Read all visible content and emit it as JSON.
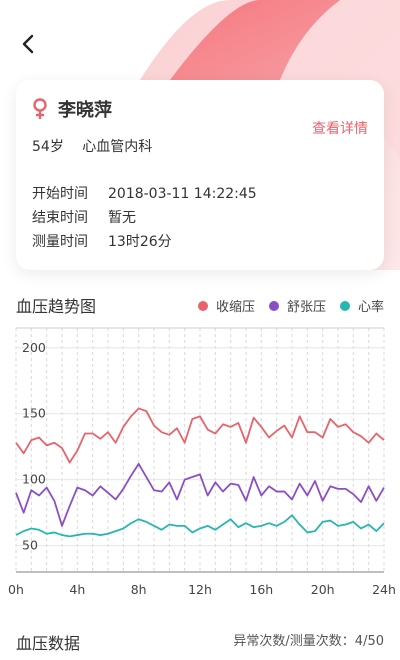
{
  "patient": {
    "name": "李晓萍",
    "age": "54岁",
    "department": "心血管内科",
    "detail_link": "查看详情"
  },
  "info_rows": [
    {
      "label": "开始时间",
      "value": "2018-03-11 14:22:45"
    },
    {
      "label": "结束时间",
      "value": "暂无"
    },
    {
      "label": "测量时间",
      "value": "13时26分"
    }
  ],
  "chart_section": {
    "title": "血压趋势图"
  },
  "data_section": {
    "title": "血压数据",
    "summary": "异常次数/测量次数：4/50"
  },
  "icons": {
    "back": "chevron-left-icon",
    "gender": "female-icon"
  },
  "colors": {
    "systolic": "#e8636b",
    "diastolic": "#8a4fc7",
    "heart_rate": "#28b6b0",
    "accent": "#e8636b",
    "grid": "#d9d9d9"
  },
  "chart_data": {
    "type": "line",
    "title": "血压趋势图",
    "xlabel": "",
    "ylabel": "",
    "x_ticks": [
      "0h",
      "4h",
      "8h",
      "12h",
      "16h",
      "20h",
      "24h"
    ],
    "y_ticks": [
      50,
      100,
      150,
      200
    ],
    "xlim": [
      0,
      24
    ],
    "ylim": [
      30,
      215
    ],
    "grid": "vertical dashed, horizontal solid",
    "legend": "top-right",
    "x": [
      0,
      0.5,
      1,
      1.5,
      2,
      2.5,
      3,
      3.5,
      4,
      4.5,
      5,
      5.5,
      6,
      6.5,
      7,
      7.5,
      8,
      8.5,
      9,
      9.5,
      10,
      10.5,
      11,
      11.5,
      12,
      12.5,
      13,
      13.5,
      14,
      14.5,
      15,
      15.5,
      16,
      16.5,
      17,
      17.5,
      18,
      18.5,
      19,
      19.5,
      20,
      20.5,
      21,
      21.5,
      22,
      22.5,
      23,
      23.5,
      24
    ],
    "series": [
      {
        "name": "收缩压",
        "values": [
          128,
          120,
          130,
          132,
          126,
          128,
          124,
          113,
          122,
          135,
          135,
          131,
          136,
          128,
          140,
          148,
          154,
          152,
          141,
          136,
          134,
          139,
          128,
          146,
          148,
          138,
          135,
          142,
          140,
          143,
          128,
          147,
          140,
          132,
          137,
          141,
          132,
          148,
          136,
          136,
          132,
          146,
          140,
          142,
          136,
          133,
          128,
          135,
          130
        ]
      },
      {
        "name": "舒张压",
        "values": [
          90,
          75,
          92,
          88,
          94,
          84,
          65,
          80,
          94,
          92,
          88,
          95,
          90,
          85,
          93,
          103,
          112,
          102,
          92,
          91,
          98,
          85,
          100,
          102,
          104,
          88,
          98,
          91,
          97,
          96,
          84,
          102,
          88,
          95,
          91,
          91,
          85,
          97,
          88,
          99,
          84,
          95,
          93,
          93,
          89,
          83,
          95,
          84,
          94
        ]
      },
      {
        "name": "心率",
        "values": [
          58,
          61,
          63,
          62,
          59,
          60,
          58,
          57,
          58,
          59,
          59,
          58,
          59,
          61,
          63,
          67,
          70,
          68,
          65,
          62,
          66,
          65,
          65,
          60,
          63,
          65,
          62,
          66,
          70,
          64,
          67,
          64,
          65,
          67,
          65,
          68,
          73,
          66,
          60,
          61,
          68,
          69,
          65,
          66,
          68,
          63,
          66,
          61,
          67
        ]
      }
    ]
  }
}
